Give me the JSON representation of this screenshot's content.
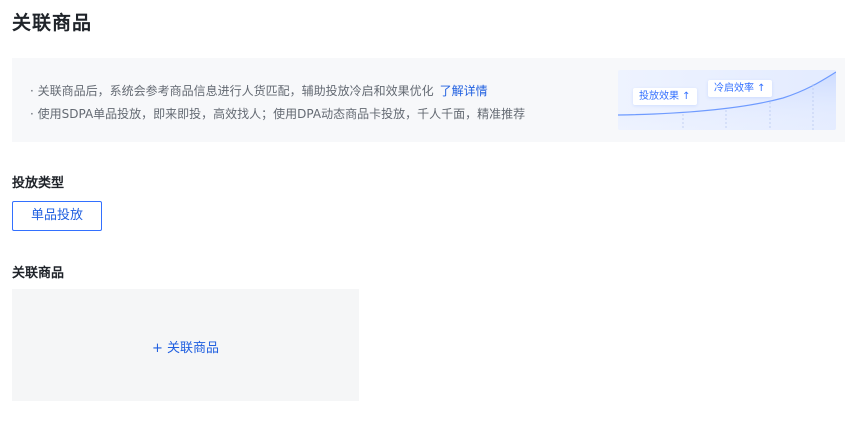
{
  "page": {
    "title": "关联商品"
  },
  "info": {
    "line1": "· 关联商品后，系统会参考商品信息进行人货匹配，辅助投放冷启和效果优化",
    "line1_link": "了解详情",
    "line2": "· 使用SDPA单品投放，即来即投，高效找人；使用DPA动态商品卡投放，千人千面，精准推荐",
    "illustration": {
      "tag_effect": "投放效果 ↑",
      "tag_coldstart": "冷启效率 ↑"
    }
  },
  "delivery_type": {
    "label": "投放类型",
    "selected_option": "单品投放"
  },
  "linked_products": {
    "label": "关联商品",
    "add_label": "+ 关联商品"
  },
  "colors": {
    "accent": "#3370ff",
    "link": "#1f5fe0",
    "panel_bg": "#f7f8fa",
    "text_primary": "#1f2329",
    "text_secondary": "#646a73"
  }
}
